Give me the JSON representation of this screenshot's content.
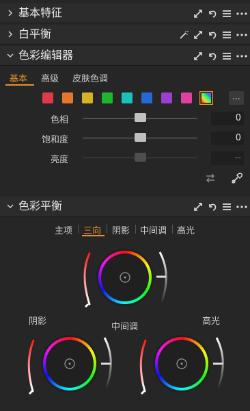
{
  "panels": {
    "basic": {
      "title": "基本特征"
    },
    "wb": {
      "title": "白平衡"
    },
    "color_editor": {
      "title": "色彩编辑器"
    },
    "color_balance": {
      "title": "色彩平衡"
    }
  },
  "color_editor": {
    "tabs": [
      "基本",
      "高级",
      "皮肤色调"
    ],
    "active_tab": "基本",
    "swatch_colors": [
      "#e03a4a",
      "#e5772d",
      "#d6b227",
      "#1fb52f",
      "#18c2bb",
      "#2867d6",
      "#9b3fcf",
      "#e0409e"
    ],
    "more_label": "...",
    "sliders": [
      {
        "label": "色相",
        "value": "0"
      },
      {
        "label": "饱和度",
        "value": "0"
      },
      {
        "label": "亮度",
        "value": "--"
      }
    ]
  },
  "color_balance": {
    "tabs": [
      "主项",
      "三向",
      "阴影",
      "中间调",
      "高光"
    ],
    "active_tab": "三向",
    "wheels": {
      "shadow_label": "阴影",
      "midtone_label": "中间调",
      "highlight_label": "高光"
    }
  }
}
